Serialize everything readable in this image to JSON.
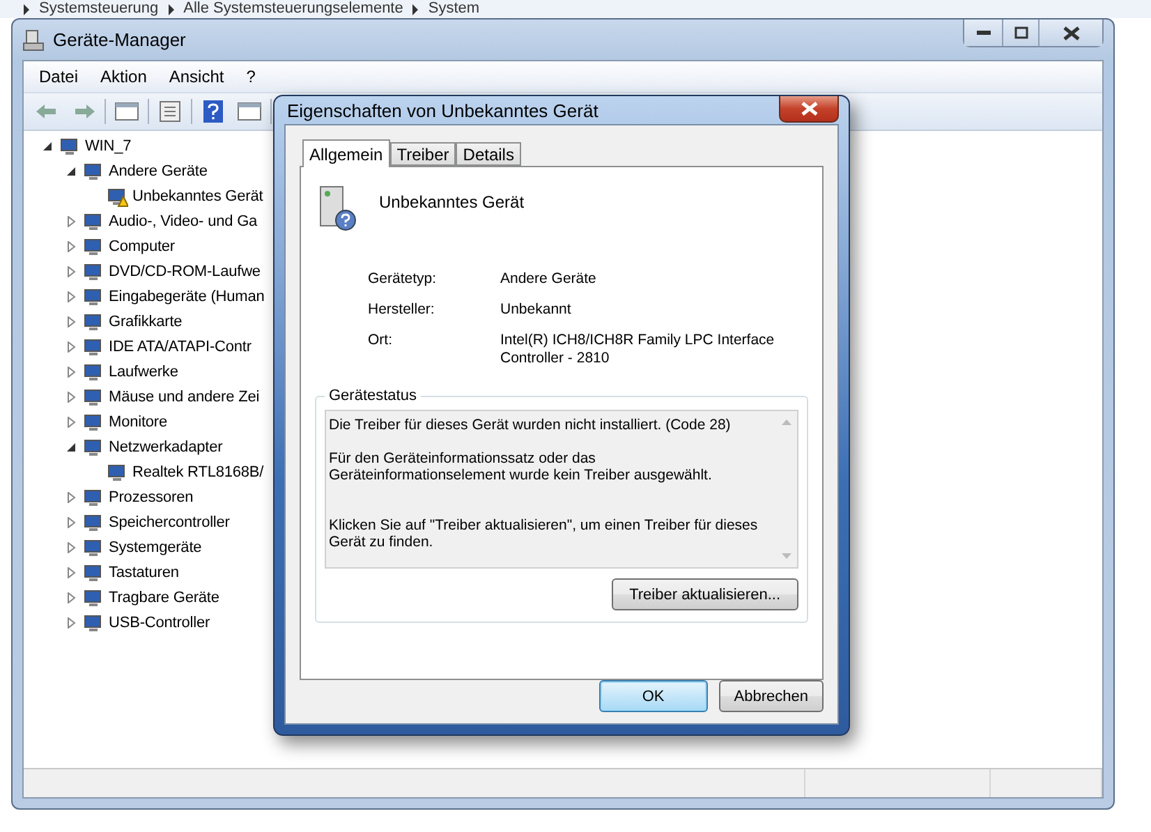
{
  "background_window": {
    "breadcrumb": [
      "Systemsteuerung",
      "Alle Systemsteuerungselemente",
      "System"
    ]
  },
  "main_window": {
    "title": "Geräte-Manager",
    "menu": [
      "Datei",
      "Aktion",
      "Ansicht",
      "?"
    ],
    "tree": [
      {
        "label": "WIN_7",
        "expanded": true,
        "children": [
          {
            "label": "Andere Geräte",
            "expanded": true,
            "children": [
              {
                "label": "Unbekanntes Gerät",
                "warning": true
              }
            ]
          },
          {
            "label": "Audio-, Video- und Ga",
            "expanded": false
          },
          {
            "label": "Computer",
            "expanded": false
          },
          {
            "label": "DVD/CD-ROM-Laufwe",
            "expanded": false
          },
          {
            "label": "Eingabegeräte (Human",
            "expanded": false
          },
          {
            "label": "Grafikkarte",
            "expanded": false
          },
          {
            "label": "IDE ATA/ATAPI-Contr",
            "expanded": false
          },
          {
            "label": "Laufwerke",
            "expanded": false
          },
          {
            "label": "Mäuse und andere Zei",
            "expanded": false
          },
          {
            "label": "Monitore",
            "expanded": false
          },
          {
            "label": "Netzwerkadapter",
            "expanded": true,
            "children": [
              {
                "label": "Realtek RTL8168B/",
                "warning": false
              }
            ]
          },
          {
            "label": "Prozessoren",
            "expanded": false
          },
          {
            "label": "Speichercontroller",
            "expanded": false
          },
          {
            "label": "Systemgeräte",
            "expanded": false
          },
          {
            "label": "Tastaturen",
            "expanded": false
          },
          {
            "label": "Tragbare Geräte",
            "expanded": false
          },
          {
            "label": "USB-Controller",
            "expanded": false
          }
        ]
      }
    ]
  },
  "dialog": {
    "title": "Eigenschaften von Unbekanntes Gerät",
    "tabs": [
      {
        "label": "Allgemein",
        "selected": true
      },
      {
        "label": "Treiber",
        "selected": false
      },
      {
        "label": "Details",
        "selected": false
      }
    ],
    "device_name": "Unbekanntes Gerät",
    "properties": [
      {
        "label": "Gerätetyp:",
        "value": "Andere Geräte"
      },
      {
        "label": "Hersteller:",
        "value": "Unbekannt"
      },
      {
        "label": "Ort:",
        "value": "Intel(R) ICH8/ICH8R Family LPC Interface Controller - 2810"
      }
    ],
    "status": {
      "title": "Gerätestatus",
      "paragraphs": [
        "Die Treiber für dieses Gerät wurden nicht installiert. (Code 28)",
        "Für den Geräteinformationssatz oder das Geräteinformationselement wurde kein Treiber ausgewählt.",
        "Klicken Sie auf \"Treiber aktualisieren\", um einen Treiber für dieses Gerät zu finden."
      ],
      "button": "Treiber aktualisieren..."
    },
    "buttons": [
      {
        "label": "OK",
        "default": true
      },
      {
        "label": "Abbrechen",
        "default": false
      }
    ]
  }
}
